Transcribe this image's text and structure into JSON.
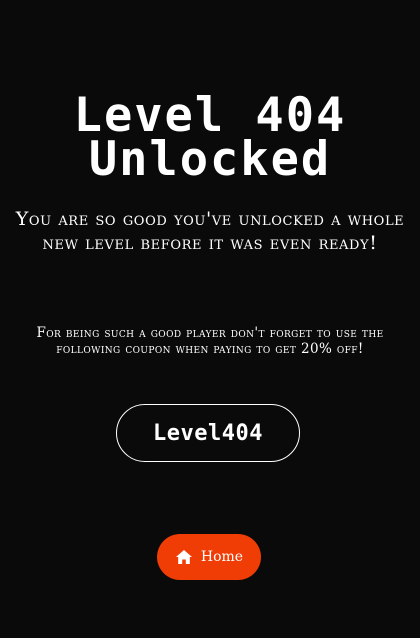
{
  "page": {
    "title_line1": "Level 404",
    "title_line2": "Unlocked",
    "subtitle": "You are so good you've unlocked a whole new level before it was even ready!",
    "promo_text": "For being such a good player don't forget to use the following coupon when paying to get 20% off!",
    "coupon_code": "Level404"
  },
  "home_button": {
    "label": "Home",
    "icon": "home-icon"
  },
  "colors": {
    "background": "#0a0a0a",
    "text": "#ffffff",
    "accent": "#f03c05"
  }
}
